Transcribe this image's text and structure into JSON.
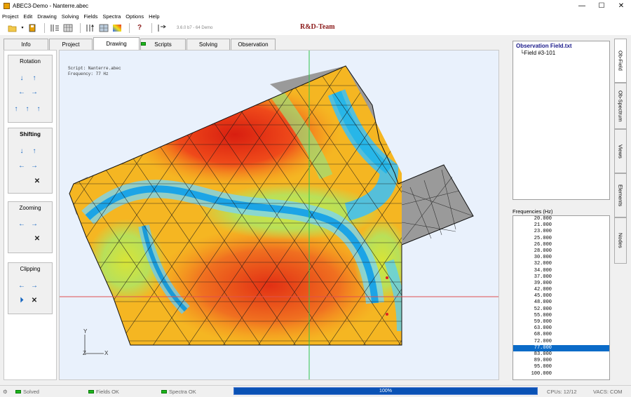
{
  "window": {
    "title": "ABEC3-Demo - Nanterre.abec",
    "controls": [
      "—",
      "☐",
      "✕"
    ]
  },
  "menu": [
    "Project",
    "Edit",
    "Drawing",
    "Solving",
    "Fields",
    "Spectra",
    "Options",
    "Help"
  ],
  "toolbar": {
    "version": "3.6.0 b7 - 64 Demo",
    "brand": "R&D-Team"
  },
  "tabs": [
    "Info",
    "Project",
    "Drawing",
    "Scripts",
    "Solving",
    "Observation"
  ],
  "active_tab": "Drawing",
  "left_panel": {
    "rotation": "Rotation",
    "shifting": "Shifting",
    "zooming": "Zooming",
    "clipping": "Clipping"
  },
  "canvas": {
    "script_line": "Script:    Nanterre.abec",
    "frequency_line": "Frequency:  77 Hz",
    "axis_y": "Y",
    "axis_z": "Z",
    "axis_x": "X"
  },
  "observation": {
    "title": "Observation Field.txt",
    "item": "Field #3-101"
  },
  "frequencies": {
    "label": "Frequencies  (Hz)",
    "items": [
      "20.000",
      "21.000",
      "23.000",
      "25.000",
      "26.000",
      "28.000",
      "30.000",
      "32.000",
      "34.000",
      "37.000",
      "39.000",
      "42.000",
      "45.000",
      "48.000",
      "52.000",
      "55.000",
      "59.000",
      "63.000",
      "68.000",
      "72.000",
      "77.000",
      "83.000",
      "89.000",
      "95.000",
      "100.000"
    ],
    "selected": "77.000"
  },
  "side_tabs": [
    "Ob-Field",
    "Ob-Spectrum",
    "Views",
    "Elements",
    "Nodes"
  ],
  "status": {
    "solved": "Solved",
    "fields": "Fields OK",
    "spectra": "Spectra OK",
    "progress_label": "100%",
    "progress_value": 1.0,
    "cpus": "CPUs: 12/12",
    "vacs": "VACS: COM"
  },
  "colors": {
    "accent": "#0b6bc8",
    "hot": "#e8321e",
    "cold": "#22b8ee",
    "mid": "#f4e214"
  }
}
